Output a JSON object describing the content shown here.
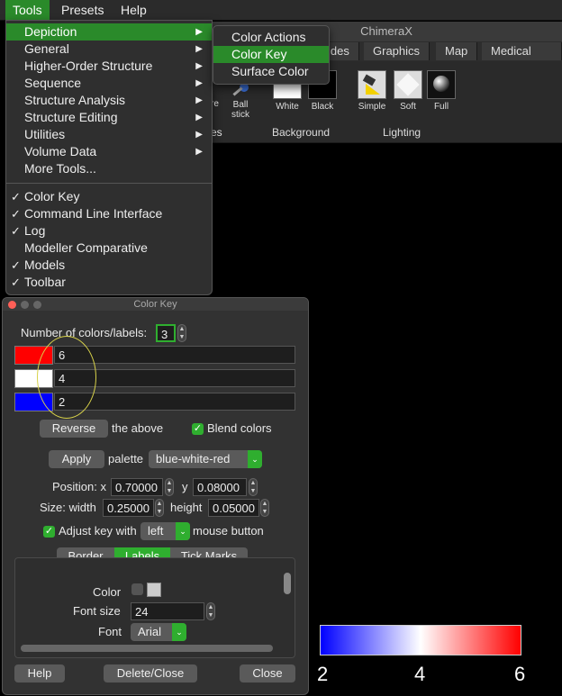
{
  "menubar": {
    "items": [
      "Tools",
      "Presets",
      "Help"
    ]
  },
  "main_window": {
    "title": "ChimeraX",
    "tabs": [
      "ides",
      "Graphics",
      "Map",
      "Medical Imag"
    ],
    "ribbon": {
      "partial_labels": [
        "re",
        "es"
      ],
      "buttons": [
        "Ball stick",
        "White",
        "Black",
        "Simple",
        "Soft",
        "Full"
      ],
      "groups": [
        "Background",
        "Lighting"
      ]
    }
  },
  "tools_menu": {
    "items": [
      {
        "label": "Depiction",
        "submenu": true,
        "active": true
      },
      {
        "label": "General",
        "submenu": true
      },
      {
        "label": "Higher-Order Structure",
        "submenu": true
      },
      {
        "label": "Sequence",
        "submenu": true
      },
      {
        "label": "Structure Analysis",
        "submenu": true
      },
      {
        "label": "Structure Editing",
        "submenu": true
      },
      {
        "label": "Utilities",
        "submenu": true
      },
      {
        "label": "Volume Data",
        "submenu": true
      },
      {
        "label": "More Tools..."
      }
    ],
    "checked_items": [
      {
        "label": "Color Key",
        "checked": true
      },
      {
        "label": "Command Line Interface",
        "checked": true
      },
      {
        "label": "Log",
        "checked": true
      },
      {
        "label": "Modeller Comparative",
        "checked": false
      },
      {
        "label": "Models",
        "checked": true
      },
      {
        "label": "Toolbar",
        "checked": true
      }
    ],
    "arrow_glyph": "▶",
    "check_glyph": "✓"
  },
  "depiction_submenu": {
    "items": [
      "Color Actions",
      "Color Key",
      "Surface Color"
    ],
    "active_index": 1
  },
  "color_key_dialog": {
    "title": "Color Key",
    "num_colors_label": "Number of colors/labels:",
    "num_colors_value": "3",
    "entries": [
      {
        "color": "#ff0000",
        "label": "6"
      },
      {
        "color": "#ffffff",
        "label": "4"
      },
      {
        "color": "#0000ff",
        "label": "2"
      }
    ],
    "reverse_button": "Reverse",
    "reverse_suffix": "the above",
    "blend_colors_label": "Blend colors",
    "blend_colors_checked": true,
    "apply_button": "Apply",
    "palette_label": "palette",
    "palette_value": "blue-white-red",
    "position_label": "Position: x",
    "position_x": "0.70000",
    "position_y_label": "y",
    "position_y": "0.08000",
    "size_label": "Size: width",
    "size_width": "0.25000",
    "size_height_label": "height",
    "size_height": "0.05000",
    "adjust_label": "Adjust key with",
    "adjust_value": "left",
    "adjust_suffix": "mouse button",
    "adjust_checked": true,
    "tabs": [
      "Border",
      "Labels",
      "Tick Marks"
    ],
    "active_tab": "Labels",
    "labels_panel": {
      "color_label": "Color",
      "font_size_label": "Font size",
      "font_size_value": "24",
      "font_label": "Font",
      "font_value": "Arial"
    },
    "buttons": {
      "help": "Help",
      "delete_close": "Delete/Close",
      "close": "Close"
    }
  },
  "color_key_graphic": {
    "labels": [
      "2",
      "4",
      "6"
    ],
    "colors": [
      "#0000ff",
      "#ffffff",
      "#ff0000"
    ]
  }
}
